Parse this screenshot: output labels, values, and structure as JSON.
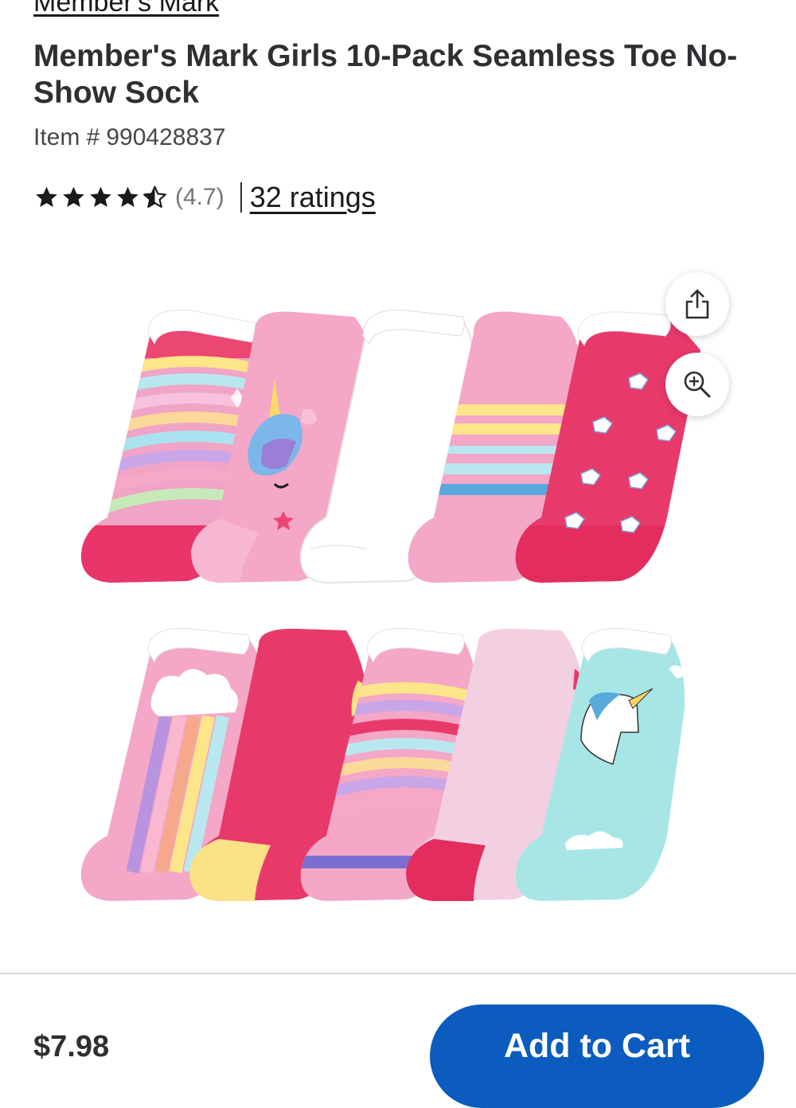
{
  "brand": {
    "link": "Member's Mark"
  },
  "product": {
    "title": "Member's Mark Girls 10-Pack Seamless Toe No-Show Sock",
    "item_label": "Item #",
    "item_number": "990428837",
    "rating": {
      "stars": 4.5,
      "value_text": "(4.7)",
      "ratings_link": "32 ratings"
    }
  },
  "image_actions": {
    "share_icon": "share-icon",
    "zoom_icon": "zoom-in-icon"
  },
  "footer": {
    "price": "$7.98",
    "add_to_cart": "Add to Cart"
  },
  "colors": {
    "accent": "#0b5cbe",
    "star": "#1a1a1a",
    "text": "#2e2f32"
  }
}
